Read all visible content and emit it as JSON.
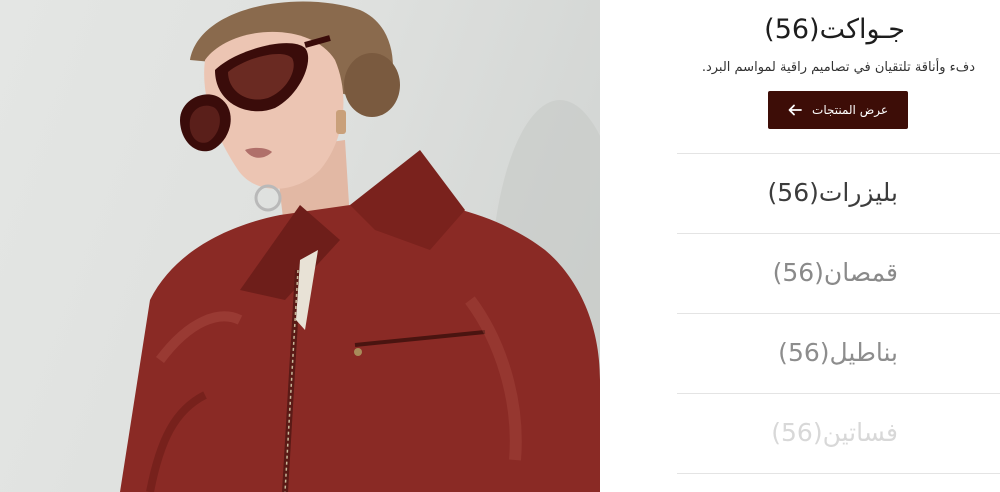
{
  "featured": {
    "title": "جـواكت(56)",
    "description": "دفء وأناقة تلتقيان في تصاميم راقية لمواسم البرد.",
    "cta_label": "عرض المنتجات"
  },
  "categories": [
    {
      "label": "بليزرات(56)"
    },
    {
      "label": "قمصان(56)"
    },
    {
      "label": "بناطيل(56)"
    },
    {
      "label": "فساتين(56)"
    }
  ],
  "colors": {
    "cta_background": "#3d0d07",
    "jacket": "#8a2a25",
    "text_primary": "#1d1d1d"
  },
  "icons": {
    "cta_icon": "arrow-left-icon"
  }
}
